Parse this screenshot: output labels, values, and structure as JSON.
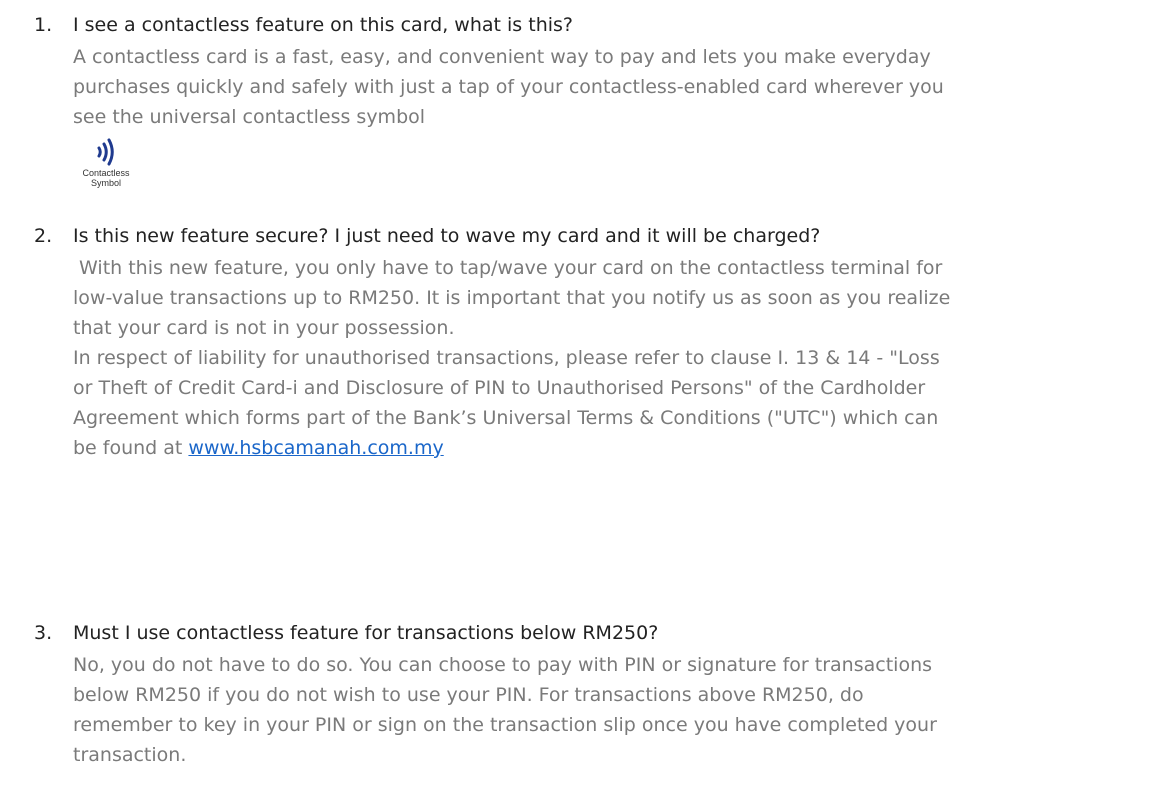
{
  "faq": [
    {
      "number": "1.",
      "question": "I see a contactless feature on this card, what is this?",
      "answer_lines": [
        "A contactless card is a fast, easy, and convenient way to pay and lets you make everyday",
        "purchases quickly and safely with just a tap of your contactless-enabled card wherever you",
        "see the universal contactless symbol"
      ],
      "symbol": {
        "icon": "contactless-icon",
        "caption_line1": "Contactless",
        "caption_line2": "Symbol",
        "color": "#1f3a8f"
      }
    },
    {
      "number": "2.",
      "question": "Is this new feature secure? I just need to wave my card and it will be charged?",
      "answer_lines": [
        " With this new feature, you only have to tap/wave your card on the contactless terminal for",
        "low-value transactions up to RM250. It is important that you notify us as soon as you realize",
        "that your card is not in your possession.",
        "In respect of liability for unauthorised transactions, please refer to clause I. 13 & 14 - \"Loss",
        "or Theft of Credit Card-i and Disclosure of PIN to Unauthorised Persons\" of the Cardholder",
        "Agreement which forms part of the Bank’s Universal Terms & Conditions (\"UTC\") which can"
      ],
      "last_line_prefix": "be found at ",
      "link_text": "www.hsbcamanah.com.my"
    },
    {
      "number": "3.",
      "question": "Must I use contactless feature for transactions below RM250?",
      "answer_lines": [
        "No, you do not have to do so. You can choose to pay with PIN or signature for transactions",
        "below RM250 if you do not wish to use your PIN. For transactions above RM250, do",
        "remember to key in your PIN or sign on the transaction slip once you have completed your",
        "transaction."
      ]
    }
  ],
  "colors": {
    "question_text": "#222222",
    "answer_text": "#7a7a7a",
    "link": "#1a66c9"
  }
}
